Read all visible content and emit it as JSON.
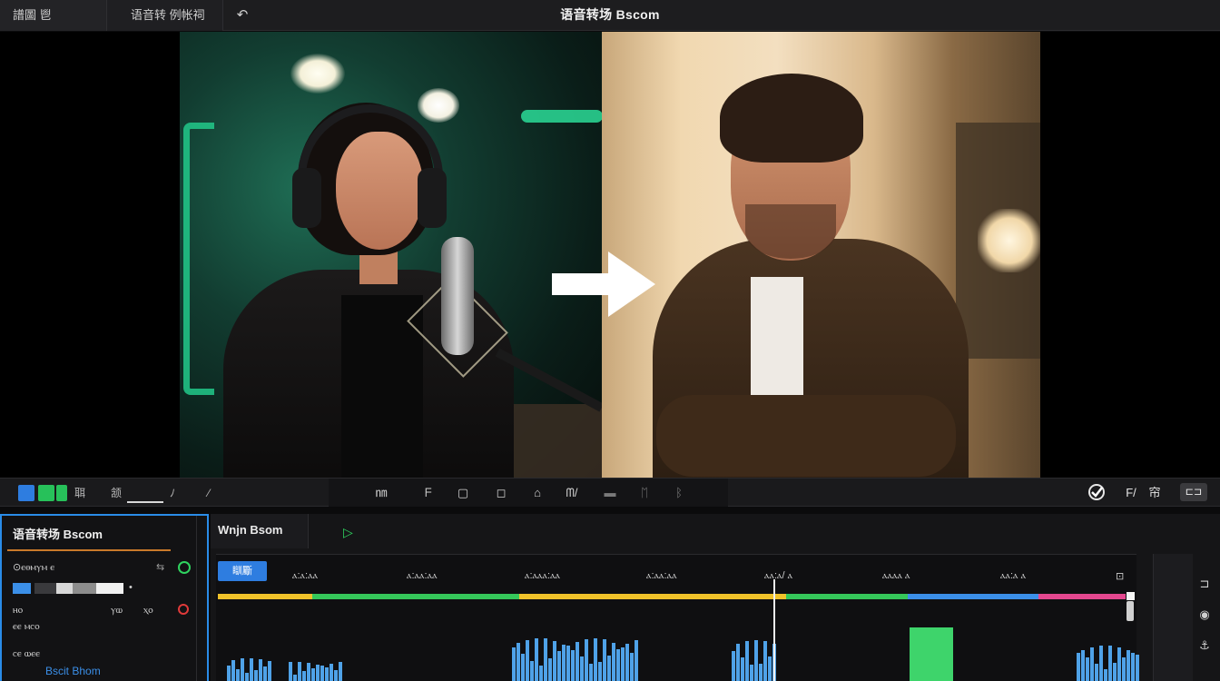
{
  "topbar": {
    "left_menu": "譜圖 鬯",
    "second_menu": "语音转 例帐祠",
    "undo_icon": "undo-arrow-icon",
    "title": "语音转场 Bscom"
  },
  "toolbar": {
    "left_label_1": "聑",
    "left_label_2": "颔",
    "left_label_3": "ﾉ",
    "left_label_4": "⁄",
    "center_labels": [
      "㎚",
      "ᖴ",
      "▢",
      "◻",
      "⌂",
      "ᗰ/",
      "▬",
      "ᛖ",
      "ᛒ"
    ],
    "right_labels": [
      "F/",
      "帘"
    ],
    "export_label": "⊏⊐",
    "accent_blue": "#2e7de0",
    "accent_green": "#27c15a"
  },
  "left_panel": {
    "title": "语音转场 Bscom",
    "row1_label": "⊙ⲉⲑⲙⲩⲙ ⲉ",
    "row2_labels": [
      "ⲏⲟ",
      "ⲩⲱ",
      "ⲭⲟ"
    ],
    "row3_label": "ⲉⲉ ⲙⲥⲟ",
    "row4_label": "ⲥⲉ ⲱⲉⲉ",
    "link_text": "Bscit Bhom",
    "border_color": "#2a8ce8",
    "rule_color": "#c97a2a"
  },
  "timeline": {
    "tab_label": "Wnjn Bsom",
    "badge_label": "瞓斸",
    "tick_labels": [
      "ⲁ:ⲁ:ⲁⲁ",
      "ⲁ:ⲁⲁ:ⲁⲁ",
      "ⲁ:ⲁⲁⲁ:ⲁⲁ",
      "ⲁ:ⲁⲁ:ⲁⲁ",
      "ⲁⲁ:ⲁ/ ⲁ",
      "ⲁⲁⲁⲁ ⲁ",
      "ⲁⲁ:ⲁ ⲁ",
      "⊡"
    ],
    "segment_colors": [
      "#f0c22a",
      "#35c75a",
      "#f0c22a",
      "#35c75a",
      "#3b8fe8",
      "#e4478f"
    ],
    "waveform_color": "#4fa2e8",
    "highlight_color": "#3ed46b"
  }
}
